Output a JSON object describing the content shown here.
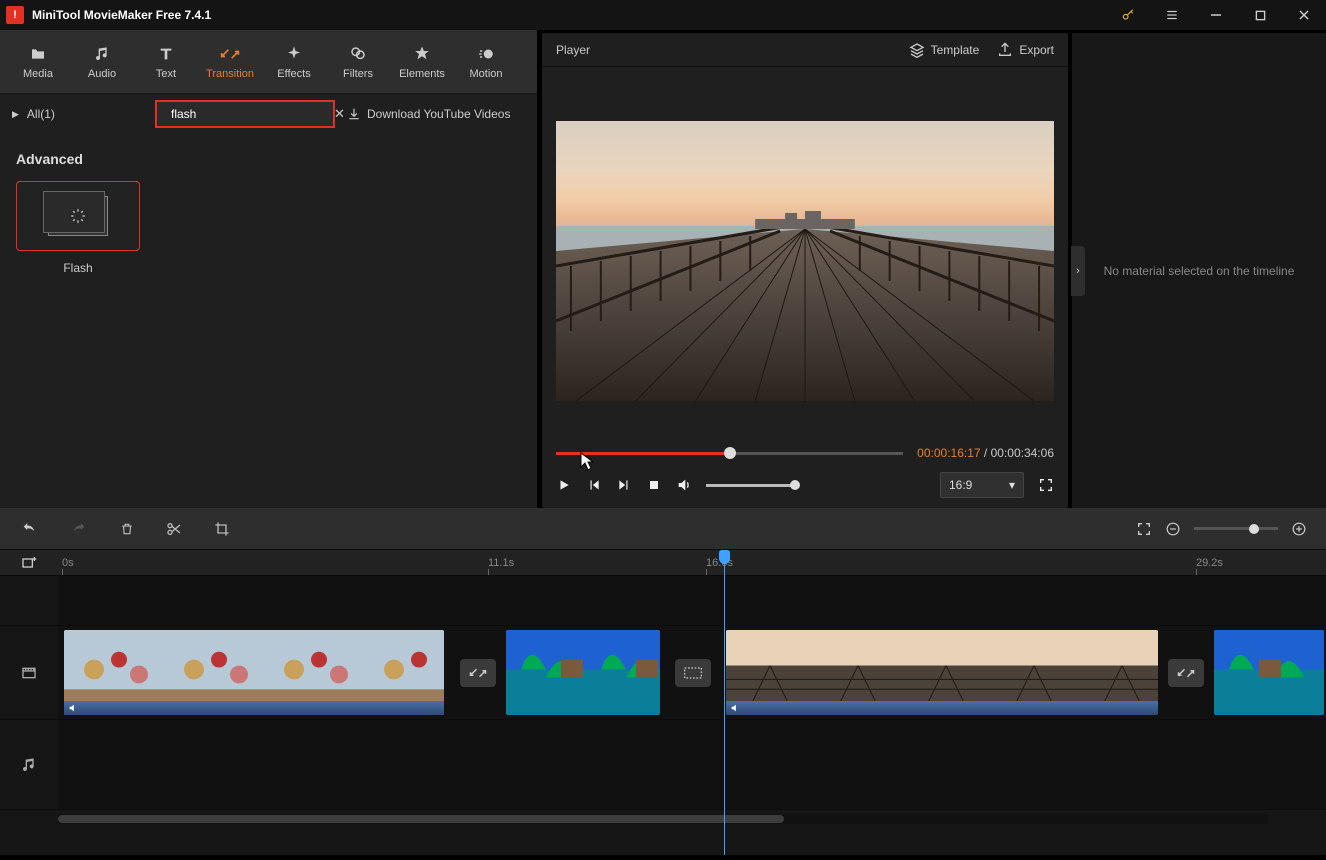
{
  "app": {
    "title": "MiniTool MovieMaker Free 7.4.1"
  },
  "tabs": {
    "media": "Media",
    "audio": "Audio",
    "text": "Text",
    "transition": "Transition",
    "effects": "Effects",
    "filters": "Filters",
    "elements": "Elements",
    "motion": "Motion"
  },
  "browser": {
    "category": "All(1)",
    "search_value": "flash",
    "download_link": "Download YouTube Videos",
    "section": "Advanced",
    "item_name": "Flash"
  },
  "player": {
    "title": "Player",
    "template": "Template",
    "export": "Export",
    "current": "00:00:16:17",
    "total": "00:00:34:06",
    "aspect": "16:9"
  },
  "props": {
    "empty": "No material selected on the timeline"
  },
  "ruler": {
    "t0": "0s",
    "t1": "11.1s",
    "t2": "16.6s",
    "t3": "29.2s"
  }
}
